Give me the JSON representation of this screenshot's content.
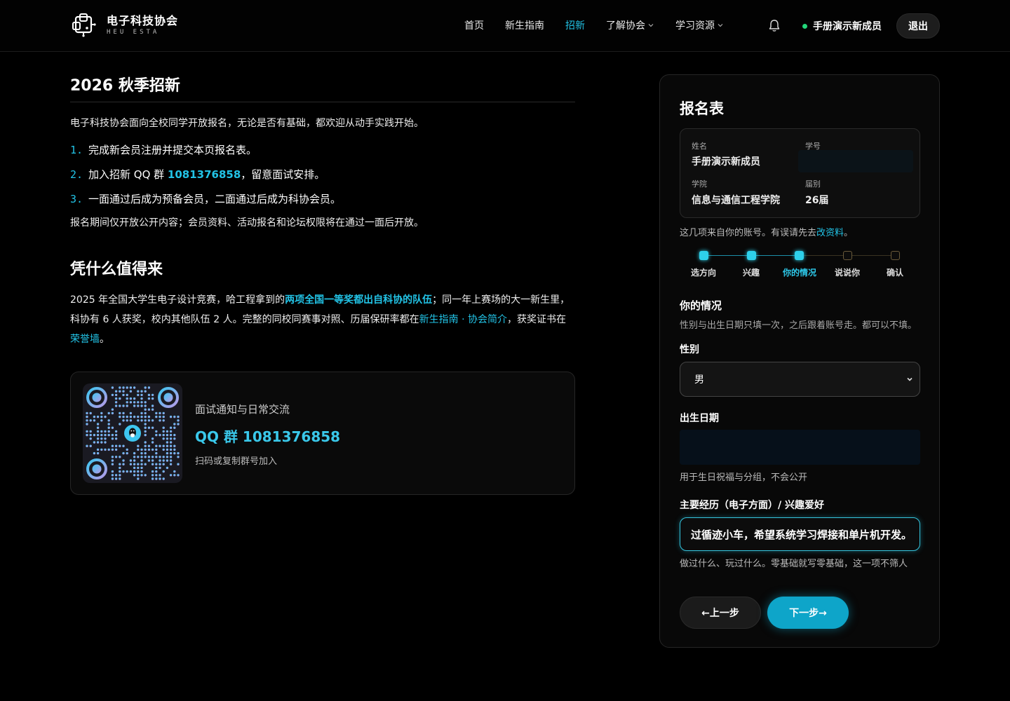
{
  "brand": {
    "title": "电子科技协会",
    "subtitle": "HEU ESTA"
  },
  "nav": {
    "items": [
      {
        "label": "首页",
        "active": false,
        "dropdown": false
      },
      {
        "label": "新生指南",
        "active": false,
        "dropdown": false
      },
      {
        "label": "招新",
        "active": true,
        "dropdown": false
      },
      {
        "label": "了解协会",
        "active": false,
        "dropdown": true
      },
      {
        "label": "学习资源",
        "active": false,
        "dropdown": true
      }
    ],
    "user": "手册演示新成员",
    "logout": "退出"
  },
  "left": {
    "title": "2026 秋季招新",
    "intro": "电子科技协会面向全校同学开放报名，无论是否有基础，都欢迎从动手实践开始。",
    "steps": [
      {
        "num": "1.",
        "text_a": "完成新会员注册并提交本页报名表。",
        "qq": "",
        "text_b": ""
      },
      {
        "num": "2.",
        "text_a": "加入招新 QQ 群 ",
        "qq": "1081376858",
        "text_b": "，留意面试安排。"
      },
      {
        "num": "3.",
        "text_a": "一面通过后成为预备会员，二面通过后成为科协会员。",
        "qq": "",
        "text_b": ""
      }
    ],
    "notice": "报名期间仅开放公开内容；会员资料、活动报名和论坛权限将在通过一面后开放。",
    "why_title": "凭什么值得来",
    "why_p1": "2025 年全国大学生电子设计竞赛，哈工程拿到的",
    "why_link1": "两项全国一等奖都出自科协的队伍",
    "why_p2": "；同一年上赛场的大一新生里，科协有 6 人获奖，校内其他队伍 2 人。完整的同校同赛事对照、历届保研率都在",
    "why_link2": "新生指南 · 协会简介",
    "why_p3": "，获奖证书在",
    "why_link3": "荣誉墙",
    "why_p4": "。",
    "card": {
      "subtitle": "面试通知与日常交流",
      "title": "QQ 群 1081376858",
      "hint": "扫码或复制群号加入"
    }
  },
  "form": {
    "title": "报名表",
    "info": {
      "name_label": "姓名",
      "name_value": "手册演示新成员",
      "id_label": "学号",
      "id_value": "",
      "college_label": "学院",
      "college_value": "信息与通信工程学院",
      "year_label": "届别",
      "year_value": "26届"
    },
    "note_prefix": "这几项来自你的账号。有误请先去",
    "note_link": "改资料",
    "note_suffix": "。",
    "steps": [
      {
        "label": "选方向",
        "done": true
      },
      {
        "label": "兴趣",
        "done": true
      },
      {
        "label": "你的情况",
        "done": true,
        "active": true
      },
      {
        "label": "说说你",
        "done": false
      },
      {
        "label": "确认",
        "done": false
      }
    ],
    "section_title": "你的情况",
    "section_desc": "性别与出生日期只填一次，之后跟着账号走。都可以不填。",
    "gender_label": "性别",
    "gender_value": "男",
    "birth_label": "出生日期",
    "birth_value": "",
    "birth_hint": "用于生日祝福与分组，不会公开",
    "exp_label": "主要经历（电子方面）/ 兴趣爱好",
    "exp_value": "过循迹小车，希望系统学习焊接和单片机开发。",
    "exp_hint": "做过什么、玩过什么。零基础就写零基础，这一项不筛人",
    "prev": "←上一步",
    "next": "下一步→"
  },
  "colors": {
    "accent": "#22c3e6",
    "online": "#22d679",
    "button": "#0ea5c9"
  }
}
